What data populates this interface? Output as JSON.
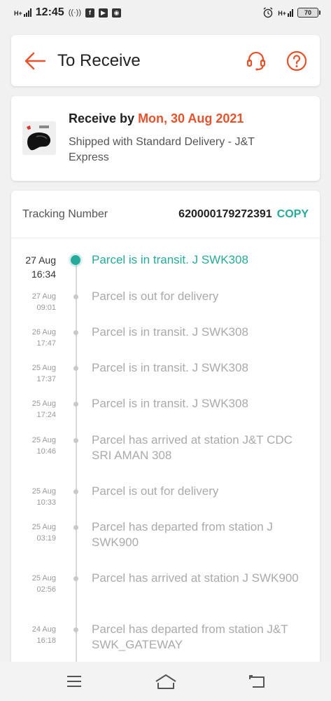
{
  "status_bar": {
    "network": "H+",
    "time": "12:45",
    "app_icons": [
      "f",
      "▶",
      "◉"
    ],
    "right_net": "H+",
    "battery": "70"
  },
  "header": {
    "title": "To Receive",
    "back_icon": "arrow-left-icon",
    "support_icon": "headset-icon",
    "help_icon": "question-circle-icon",
    "accent": "#e5532d"
  },
  "delivery": {
    "receive_prefix": "Receive by ",
    "receive_date": "Mon, 30 Aug 2021",
    "shipped_text": "Shipped with Standard Delivery  - J&T Express"
  },
  "tracking": {
    "label": "Tracking Number",
    "number": "620000179272391",
    "copy_label": "COPY",
    "accent": "#26aa99",
    "events": [
      {
        "date": "27 Aug",
        "time": "16:34",
        "text": "Parcel is in transit. J SWK308",
        "active": true
      },
      {
        "date": "27 Aug",
        "time": "09:01",
        "text": "Parcel is out for delivery",
        "active": false
      },
      {
        "date": "26 Aug",
        "time": "17:47",
        "text": "Parcel is in transit. J SWK308",
        "active": false
      },
      {
        "date": "25 Aug",
        "time": "17:37",
        "text": "Parcel is in transit. J SWK308",
        "active": false
      },
      {
        "date": "25 Aug",
        "time": "17:24",
        "text": "Parcel is in transit. J SWK308",
        "active": false
      },
      {
        "date": "25 Aug",
        "time": "10:46",
        "text": "Parcel has arrived at station J&T CDC SRI AMAN 308",
        "active": false
      },
      {
        "date": "25 Aug",
        "time": "10:33",
        "text": "Parcel is out for delivery",
        "active": false
      },
      {
        "date": "25 Aug",
        "time": "03:19",
        "text": "Parcel has departed from station J SWK900",
        "active": false
      },
      {
        "date": "25 Aug",
        "time": "02:56",
        "text": "Parcel has arrived at station J SWK900",
        "active": false
      },
      {
        "date": "24 Aug",
        "time": "16:18",
        "text": "Parcel has departed from station J&T SWK_GATEWAY",
        "active": false
      }
    ]
  },
  "navbar": {
    "menu_icon": "menu-icon",
    "home_icon": "home-icon",
    "back_icon": "back-icon"
  }
}
